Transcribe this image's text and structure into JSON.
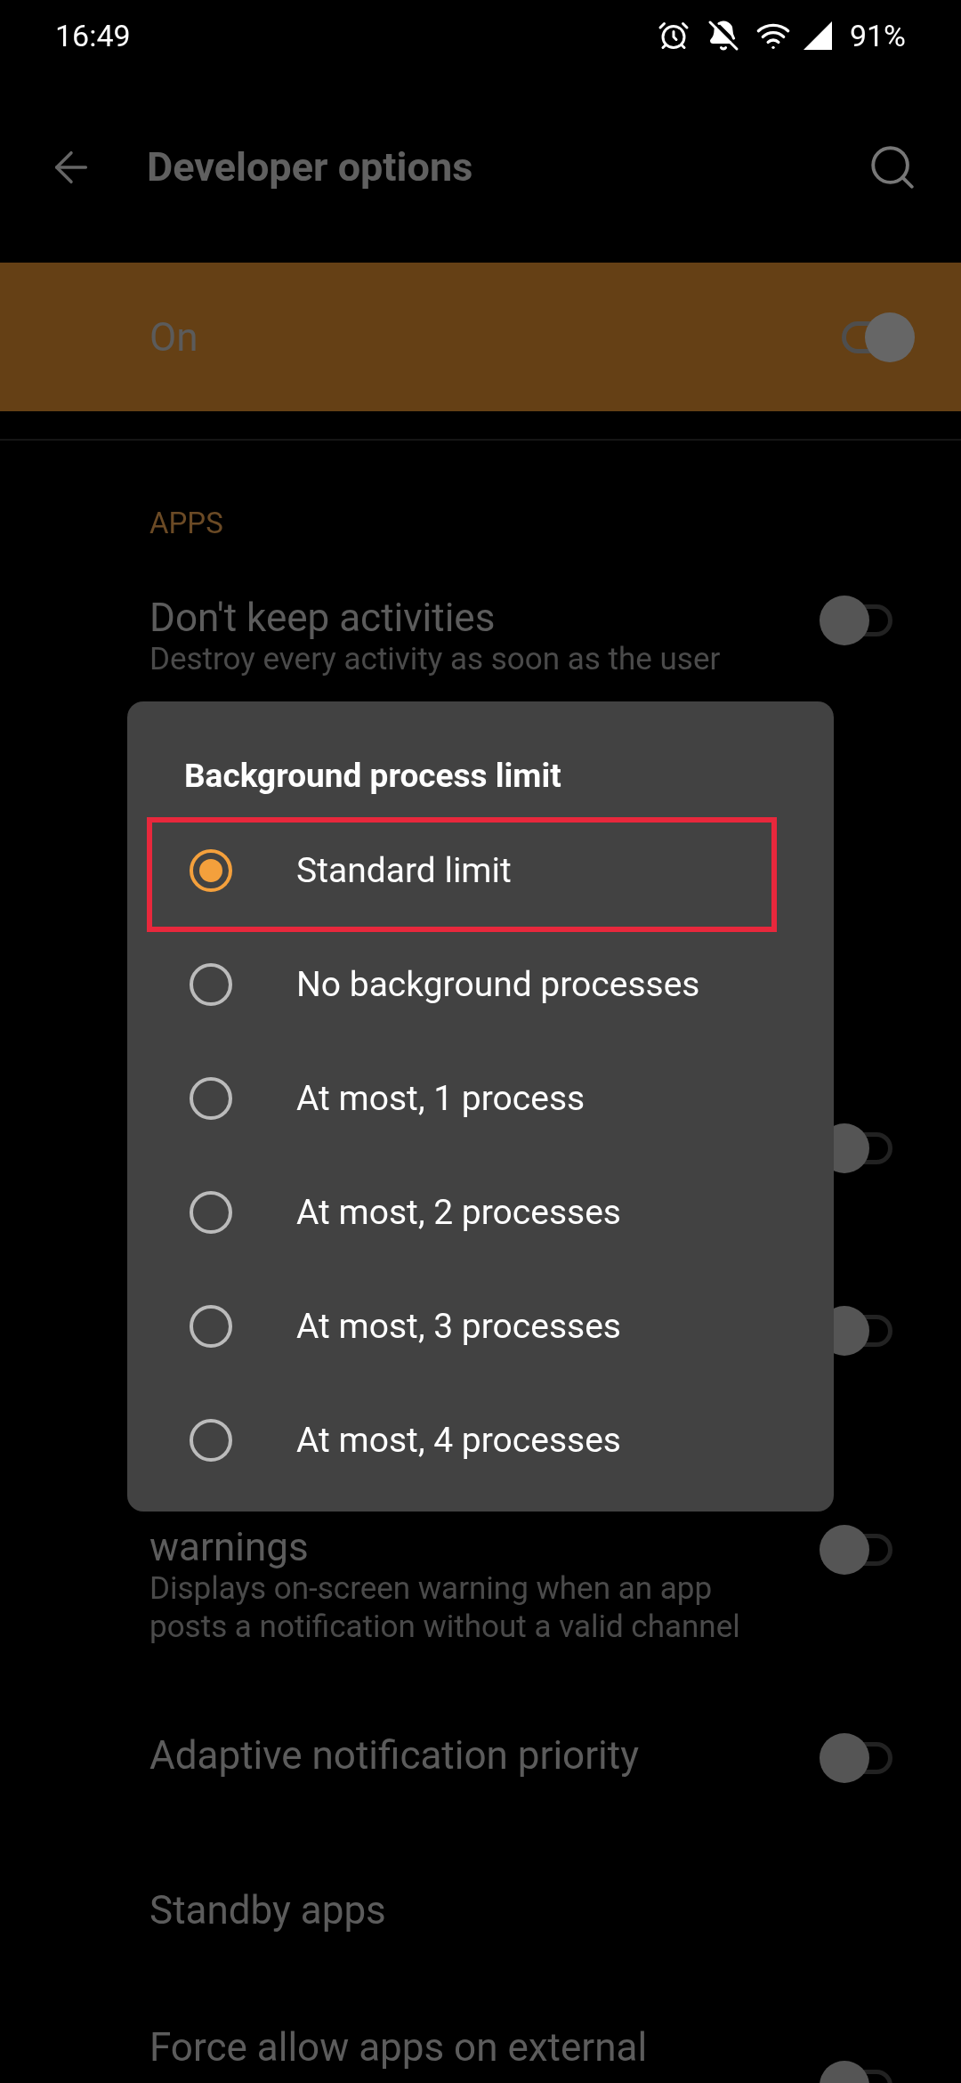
{
  "status_bar": {
    "time": "16:49",
    "battery": "91%"
  },
  "toolbar": {
    "title": "Developer options"
  },
  "master_switch": {
    "label": "On",
    "on": true
  },
  "section": {
    "title": "APPS"
  },
  "rows": [
    {
      "kind": "setting",
      "title": "Don't keep activities",
      "subtitle": "Destroy every activity as soon as the user",
      "on": false
    },
    {
      "kind": "hidden",
      "on": false
    },
    {
      "kind": "hidden",
      "on": false
    },
    {
      "kind": "setting",
      "title": "warnings",
      "subtitle": "Displays on-screen warning when an app posts a notification without a valid channel",
      "on": false
    },
    {
      "kind": "setting",
      "title": "Adaptive notification priority",
      "on": false
    },
    {
      "kind": "link",
      "title": "Standby apps"
    },
    {
      "kind": "setting",
      "title": "Force allow apps on external",
      "on": false
    }
  ],
  "dialog": {
    "title": "Background process limit",
    "options": [
      {
        "label": "Standard limit",
        "selected": true,
        "highlighted": true
      },
      {
        "label": "No background processes",
        "selected": false,
        "highlighted": false
      },
      {
        "label": "At most, 1 process",
        "selected": false,
        "highlighted": false
      },
      {
        "label": "At most, 2 processes",
        "selected": false,
        "highlighted": false
      },
      {
        "label": "At most, 3 processes",
        "selected": false,
        "highlighted": false
      },
      {
        "label": "At most, 4 processes",
        "selected": false,
        "highlighted": false
      }
    ]
  }
}
